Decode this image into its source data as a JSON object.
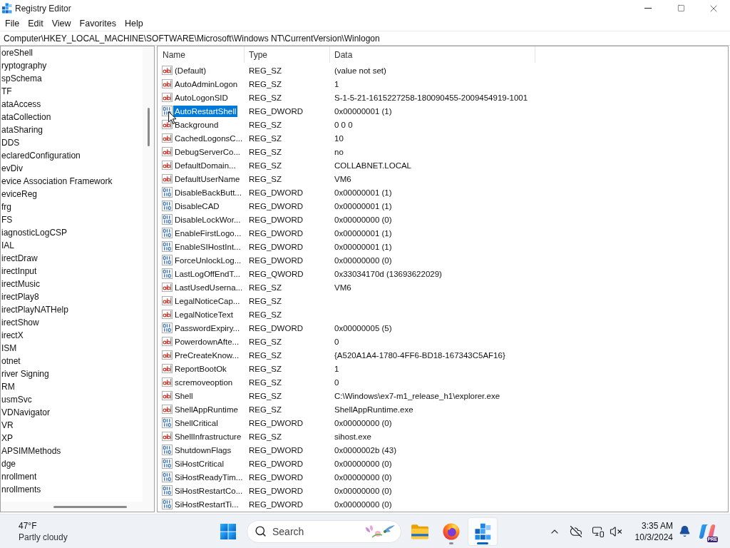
{
  "window": {
    "title": "Registry Editor"
  },
  "menu": [
    "File",
    "Edit",
    "View",
    "Favorites",
    "Help"
  ],
  "address_bar": {
    "value": "Computer\\HKEY_LOCAL_MACHINE\\SOFTWARE\\Microsoft\\Windows NT\\CurrentVersion\\Winlogon"
  },
  "tree": {
    "items": [
      "oreShell",
      "ryptography",
      "spSchema",
      "TF",
      "ataAccess",
      "ataCollection",
      "ataSharing",
      "DDS",
      "eclaredConfiguration",
      "evDiv",
      "evice Association Framework",
      "eviceReg",
      "frg",
      "FS",
      "iagnosticLogCSP",
      "IAL",
      "irectDraw",
      "irectInput",
      "irectMusic",
      "irectPlay8",
      "irectPlayNATHelp",
      "irectShow",
      "irectX",
      "ISM",
      "otnet",
      "river Signing",
      "RM",
      "usmSvc",
      "VDNavigator",
      "VR",
      "XP",
      "APSIMMethods",
      "dge",
      "nrollment",
      "nrollments"
    ]
  },
  "list": {
    "columns": [
      "Name",
      "Type",
      "Data"
    ],
    "rows": [
      {
        "kind": "string",
        "name": "(Default)",
        "type": "REG_SZ",
        "data": "(value not set)",
        "selected": false
      },
      {
        "kind": "string",
        "name": "AutoAdminLogon",
        "type": "REG_SZ",
        "data": "1",
        "selected": false
      },
      {
        "kind": "string",
        "name": "AutoLogonSID",
        "type": "REG_SZ",
        "data": "S-1-5-21-1615227258-180090455-2009454919-1001",
        "selected": false
      },
      {
        "kind": "number",
        "name": "AutoRestartShell",
        "type": "REG_DWORD",
        "data": "0x00000001 (1)",
        "selected": true
      },
      {
        "kind": "string",
        "name": "Background",
        "type": "REG_SZ",
        "data": "0 0 0",
        "selected": false
      },
      {
        "kind": "string",
        "name": "CachedLogonsC...",
        "type": "REG_SZ",
        "data": "10",
        "selected": false
      },
      {
        "kind": "string",
        "name": "DebugServerCo...",
        "type": "REG_SZ",
        "data": "no",
        "selected": false
      },
      {
        "kind": "string",
        "name": "DefaultDomain...",
        "type": "REG_SZ",
        "data": "COLLABNET.LOCAL",
        "selected": false
      },
      {
        "kind": "string",
        "name": "DefaultUserName",
        "type": "REG_SZ",
        "data": "VM6",
        "selected": false
      },
      {
        "kind": "number",
        "name": "DisableBackButt...",
        "type": "REG_DWORD",
        "data": "0x00000001 (1)",
        "selected": false
      },
      {
        "kind": "number",
        "name": "DisableCAD",
        "type": "REG_DWORD",
        "data": "0x00000001 (1)",
        "selected": false
      },
      {
        "kind": "number",
        "name": "DisableLockWor...",
        "type": "REG_DWORD",
        "data": "0x00000000 (0)",
        "selected": false
      },
      {
        "kind": "number",
        "name": "EnableFirstLogo...",
        "type": "REG_DWORD",
        "data": "0x00000001 (1)",
        "selected": false
      },
      {
        "kind": "number",
        "name": "EnableSIHostInt...",
        "type": "REG_DWORD",
        "data": "0x00000001 (1)",
        "selected": false
      },
      {
        "kind": "number",
        "name": "ForceUnlockLog...",
        "type": "REG_DWORD",
        "data": "0x00000000 (0)",
        "selected": false
      },
      {
        "kind": "number",
        "name": "LastLogOffEndT...",
        "type": "REG_QWORD",
        "data": "0x33034170d (13693622029)",
        "selected": false
      },
      {
        "kind": "string",
        "name": "LastUsedUserna...",
        "type": "REG_SZ",
        "data": "VM6",
        "selected": false
      },
      {
        "kind": "string",
        "name": "LegalNoticeCap...",
        "type": "REG_SZ",
        "selected": false
      },
      {
        "kind": "string",
        "name": "LegalNoticeText",
        "type": "REG_SZ",
        "selected": false
      },
      {
        "kind": "number",
        "name": "PasswordExpiry...",
        "type": "REG_DWORD",
        "data": "0x00000005 (5)",
        "selected": false
      },
      {
        "kind": "string",
        "name": "PowerdownAfte...",
        "type": "REG_SZ",
        "data": "0",
        "selected": false
      },
      {
        "kind": "string",
        "name": "PreCreateKnow...",
        "type": "REG_SZ",
        "data": "{A520A1A4-1780-4FF6-BD18-167343C5AF16}",
        "selected": false
      },
      {
        "kind": "string",
        "name": "ReportBootOk",
        "type": "REG_SZ",
        "data": "1",
        "selected": false
      },
      {
        "kind": "string",
        "name": "scremoveoption",
        "type": "REG_SZ",
        "data": "0",
        "selected": false
      },
      {
        "kind": "string",
        "name": "Shell",
        "type": "REG_SZ",
        "data": "C:\\Windows\\ex7-m1_release_h1\\explorer.exe",
        "selected": false
      },
      {
        "kind": "string",
        "name": "ShellAppRuntime",
        "type": "REG_SZ",
        "data": "ShellAppRuntime.exe",
        "selected": false
      },
      {
        "kind": "number",
        "name": "ShellCritical",
        "type": "REG_DWORD",
        "data": "0x00000000 (0)",
        "selected": false
      },
      {
        "kind": "string",
        "name": "ShellInfrastructure",
        "type": "REG_SZ",
        "data": "sihost.exe",
        "selected": false
      },
      {
        "kind": "number",
        "name": "ShutdownFlags",
        "type": "REG_DWORD",
        "data": "0x0000002b (43)",
        "selected": false
      },
      {
        "kind": "number",
        "name": "SiHostCritical",
        "type": "REG_DWORD",
        "data": "0x00000000 (0)",
        "selected": false
      },
      {
        "kind": "number",
        "name": "SiHostReadyTim...",
        "type": "REG_DWORD",
        "data": "0x00000000 (0)",
        "selected": false
      },
      {
        "kind": "number",
        "name": "SiHostRestartCo...",
        "type": "REG_DWORD",
        "data": "0x00000000 (0)",
        "selected": false
      },
      {
        "kind": "number",
        "name": "SiHostRestartTi...",
        "type": "REG_DWORD",
        "data": "0x00000000 (0)",
        "selected": false
      }
    ]
  },
  "taskbar": {
    "weather": {
      "temperature": "47°F",
      "condition": "Partly cloudy"
    },
    "search": {
      "label": "Search"
    },
    "apps": [
      {
        "kind": "folder",
        "running": false,
        "selected": false
      },
      {
        "kind": "browser",
        "running": true,
        "selected": false
      },
      {
        "kind": "registry",
        "running": true,
        "selected": true
      }
    ],
    "clock": {
      "time": "3:35 AM",
      "date": "10/3/2024"
    },
    "assistant_badge": "PRE"
  }
}
